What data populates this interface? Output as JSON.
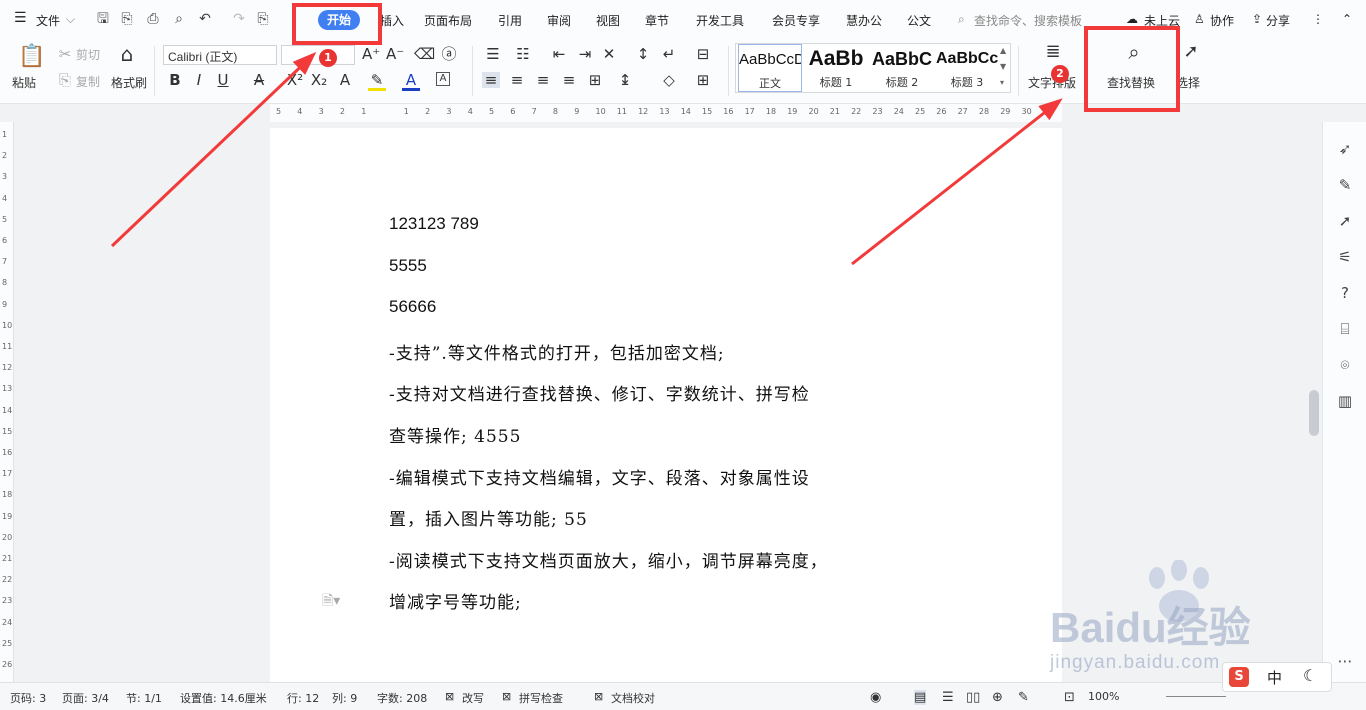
{
  "menubar": {
    "menu_label": "文件",
    "tabs": [
      "开始",
      "插入",
      "页面布局",
      "引用",
      "审阅",
      "视图",
      "章节",
      "开发工具",
      "会员专享",
      "慧办公",
      "公文"
    ],
    "search_placeholder": "查找命令、搜索模板",
    "cloud_label": "未上云",
    "collab_label": "协作",
    "share_label": "分享"
  },
  "ribbon": {
    "paste_label": "粘贴",
    "cut_label": "剪切",
    "copy_label": "复制",
    "format_painter_label": "格式刷",
    "font_name": "Calibri (正文)",
    "styles": [
      {
        "preview": "AaBbCcDd",
        "name": "正文"
      },
      {
        "preview": "AaBb",
        "name": "标题 1"
      },
      {
        "preview": "AaBbC",
        "name": "标题 2"
      },
      {
        "preview": "AaBbCcI",
        "name": "标题 3"
      }
    ],
    "text_layout_label": "文字排版",
    "find_replace_label": "查找替换",
    "select_label": "选择"
  },
  "ruler": {
    "top_ticks": [
      "5",
      "4",
      "3",
      "2",
      "1",
      "",
      "1",
      "2",
      "3",
      "4",
      "5",
      "6",
      "7",
      "8",
      "9",
      "10",
      "11",
      "12",
      "13",
      "14",
      "15",
      "16",
      "17",
      "18",
      "19",
      "20",
      "21",
      "22",
      "23",
      "24",
      "25",
      "26",
      "27",
      "28",
      "29",
      "30"
    ],
    "left_ticks": [
      "1",
      "2",
      "3",
      "4",
      "5",
      "6",
      "7",
      "8",
      "9",
      "10",
      "11",
      "12",
      "13",
      "14",
      "15",
      "16",
      "17",
      "18",
      "19",
      "20",
      "21",
      "22",
      "23",
      "24",
      "25",
      "26"
    ]
  },
  "document": {
    "lines": [
      "123123 789",
      "5555",
      "56666",
      "-支持”.等文件格式的打开，包括加密文档;",
      "-支持对文档进行查找替换、修订、字数统计、拼写检",
      "查等操作; 4555",
      "-编辑模式下支持文档编辑，文字、段落、对象属性设",
      "置，插入图片等功能; 55",
      "-阅读模式下支持文档页面放大，缩小，调节屏幕亮度，",
      "增减字号等功能;"
    ]
  },
  "status": {
    "page_num": "页码: 3",
    "pages": "页面: 3/4",
    "section": "节: 1/1",
    "setting": "设置值: 14.6厘米",
    "row": "行: 12",
    "col": "列: 9",
    "words": "字数: 208",
    "revise": "改写",
    "spell": "拼写检查",
    "doccheck": "文档校对",
    "zoom": "100%"
  },
  "annotations": {
    "badge1": "1",
    "badge2": "2"
  },
  "watermark": {
    "text": "Baidu经验",
    "url": "jingyan.baidu.com"
  },
  "ime": {
    "lang": "中"
  },
  "colors": {
    "accent": "#3f7ff2",
    "annotation": "#f23a3a"
  }
}
